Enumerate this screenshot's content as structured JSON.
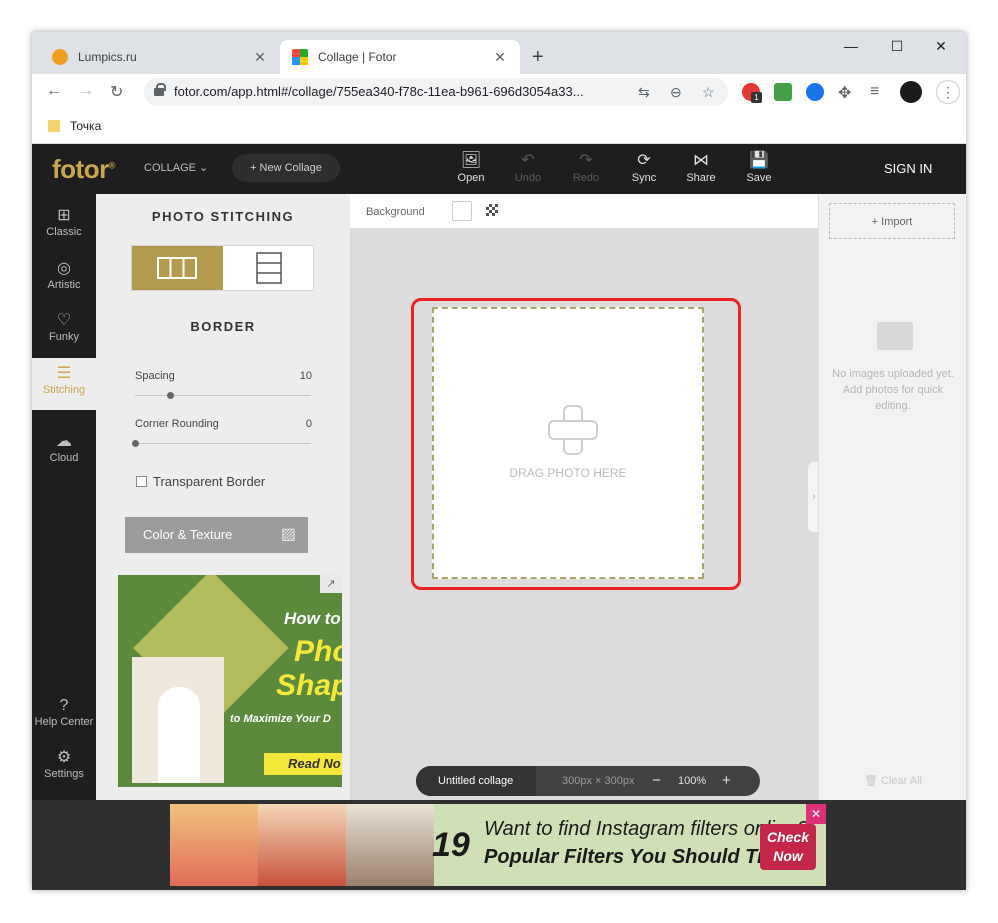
{
  "browser": {
    "tabs": [
      {
        "title": "Lumpics.ru",
        "close": "✕"
      },
      {
        "title": "Collage | Fotor",
        "close": "✕"
      }
    ],
    "new_tab": "+",
    "window_controls": {
      "minimize": "—",
      "maximize": "☐",
      "close": "✕"
    },
    "url": "fotor.com/app.html#/collage/755ea340-f78c-11ea-b961-696d3054a33...",
    "bookmark": "Точка",
    "ext_badge": "1"
  },
  "app": {
    "logo": "fotor",
    "logo_mark": "®",
    "mode": "COLLAGE",
    "new_collage": "New Collage",
    "toolbar": [
      {
        "label": "Open",
        "icon": "image-icon",
        "glyph": "🖼"
      },
      {
        "label": "Undo",
        "icon": "undo-icon",
        "glyph": "↶"
      },
      {
        "label": "Redo",
        "icon": "redo-icon",
        "glyph": "↷"
      },
      {
        "label": "Sync",
        "icon": "sync-icon",
        "glyph": "⟳"
      },
      {
        "label": "Share",
        "icon": "share-icon",
        "glyph": "⋈"
      },
      {
        "label": "Save",
        "icon": "save-icon",
        "glyph": "💾"
      }
    ],
    "sign_in": "SIGN IN",
    "rail": [
      {
        "label": "Classic",
        "icon": "classic-icon"
      },
      {
        "label": "Artistic",
        "icon": "artistic-icon"
      },
      {
        "label": "Funky",
        "icon": "funky-icon"
      },
      {
        "label": "Stitching",
        "icon": "stitching-icon"
      },
      {
        "label": "Cloud",
        "icon": "cloud-icon"
      }
    ],
    "rail_bottom": [
      {
        "label": "Help Center",
        "icon": "help-icon"
      },
      {
        "label": "Settings",
        "icon": "settings-icon"
      }
    ],
    "panel": {
      "title": "PHOTO STITCHING",
      "border_title": "BORDER",
      "spacing_label": "Spacing",
      "spacing_value": "10",
      "spacing_level": 0.2,
      "rounding_label": "Corner Rounding",
      "rounding_value": "0",
      "rounding_level": 0.0,
      "transparent_border": "Transparent Border",
      "color_texture": "Color & Texture",
      "ad": {
        "line1": "How to",
        "line2": "Pho",
        "line3": "Shap",
        "line4": "to Maximize Your D",
        "cta": "Read No"
      }
    },
    "canvas": {
      "background_label": "Background",
      "drag_text": "DRAG PHOTO HERE",
      "collage_name": "Untitled collage",
      "dims": "300px × 300px",
      "zoom_minus": "−",
      "zoom": "100%",
      "zoom_plus": "+"
    },
    "right": {
      "import": "Import",
      "no_images": "No images uploaded yet. Add photos for quick editing.",
      "clear_all": "Clear All"
    },
    "banner": {
      "number": "19",
      "line1": "Want to find Instagram filters online?",
      "line2": "Popular Filters You Should Try",
      "cta_l1": "Check",
      "cta_l2": "Now",
      "close": "✕"
    }
  },
  "colors": {
    "accent": "#c8a74e",
    "highlight": "#e22222",
    "dark": "#1e1e1e"
  }
}
